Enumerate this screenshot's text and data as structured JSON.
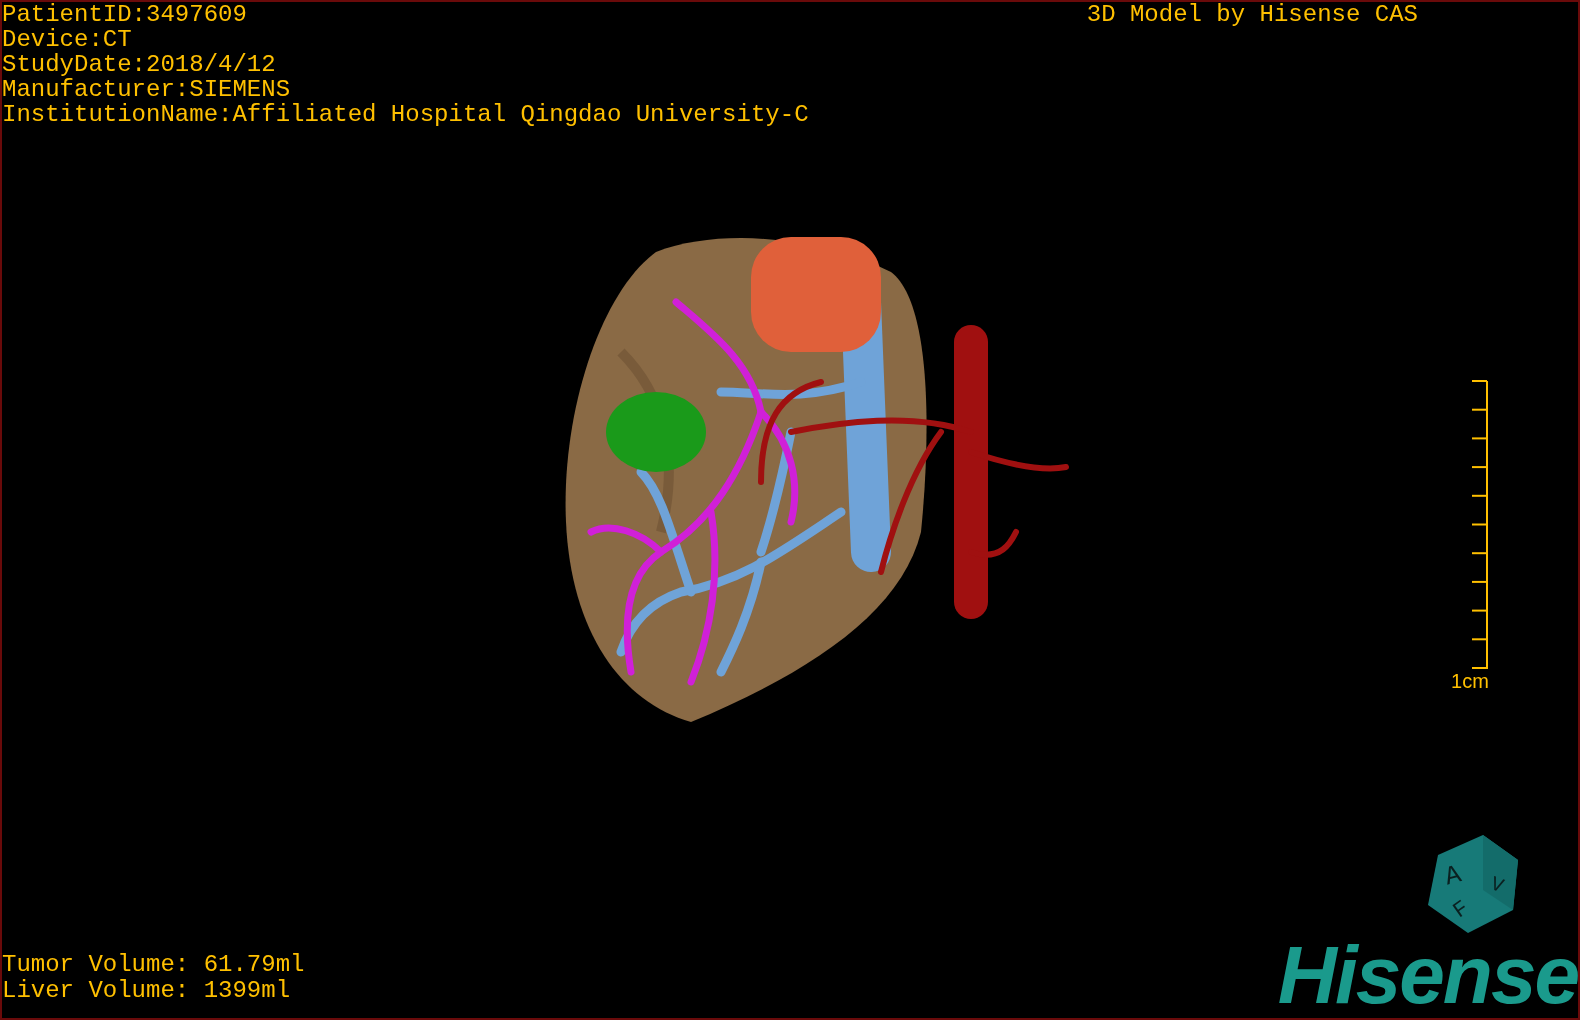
{
  "study_info": [
    "PatientID:3497609",
    "Device:CT",
    "StudyDate:2018/4/12",
    "Manufacturer:SIEMENS",
    "InstitutionName:Affiliated Hospital Qingdao University-C"
  ],
  "title": "3D Model by Hisense CAS",
  "scale_bar": {
    "label": "1cm"
  },
  "volumes": [
    "Tumor Volume: 61.79ml",
    "Liver Volume: 1399ml"
  ],
  "orientation_cube": {
    "faces": [
      "A",
      "F",
      "V"
    ]
  },
  "logo": "Hisense"
}
